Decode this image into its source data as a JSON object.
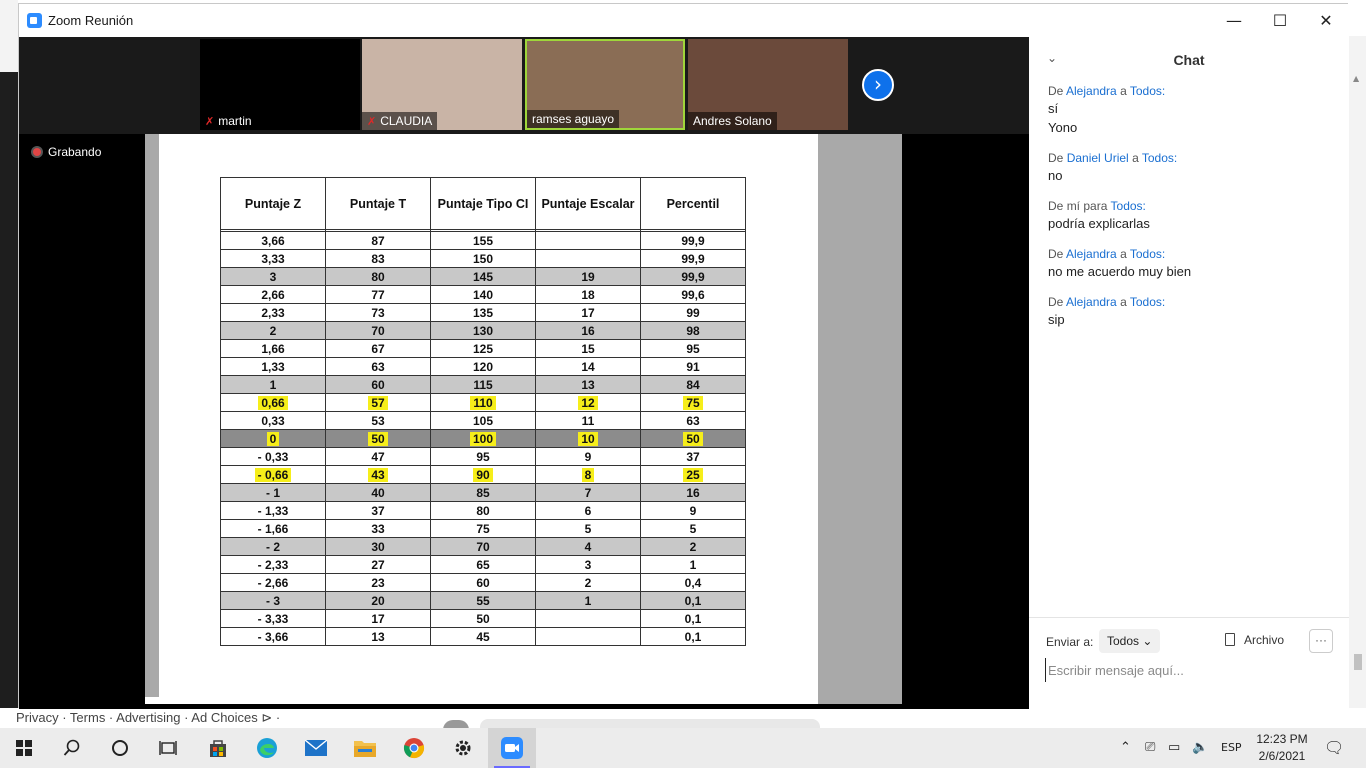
{
  "background": {
    "footer_links": "Privacy · Terms · Advertising · Ad Choices ⊳ ·"
  },
  "window": {
    "title": "Zoom Reunión",
    "controls": {
      "minimize": "—",
      "maximize": "☐",
      "close": "✕"
    }
  },
  "participants": [
    {
      "name": "martin",
      "muted": true,
      "bg": "#000000"
    },
    {
      "name": "CLAUDIA",
      "muted": true,
      "bg": "#c9b4a6"
    },
    {
      "name": "ramses aguayo",
      "muted": false,
      "bg": "#8a6d55"
    },
    {
      "name": "Andres Solano",
      "muted": false,
      "bg": "#6b4a3b"
    }
  ],
  "next_arrow": "›",
  "recording": {
    "label": "Grabando"
  },
  "table": {
    "headers": [
      "Puntaje Z",
      "Puntaje T",
      "Puntaje Tipo CI",
      "Puntaje Escalar",
      "Percentil"
    ],
    "rows": [
      {
        "cells": [
          "3,66",
          "87",
          "155",
          "",
          "99,9"
        ],
        "shade": "white"
      },
      {
        "cells": [
          "3,33",
          "83",
          "150",
          "",
          "99,9"
        ],
        "shade": "white"
      },
      {
        "cells": [
          "3",
          "80",
          "145",
          "19",
          "99,9"
        ],
        "shade": "gray"
      },
      {
        "cells": [
          "2,66",
          "77",
          "140",
          "18",
          "99,6"
        ],
        "shade": "white"
      },
      {
        "cells": [
          "2,33",
          "73",
          "135",
          "17",
          "99"
        ],
        "shade": "white"
      },
      {
        "cells": [
          "2",
          "70",
          "130",
          "16",
          "98"
        ],
        "shade": "gray"
      },
      {
        "cells": [
          "1,66",
          "67",
          "125",
          "15",
          "95"
        ],
        "shade": "white"
      },
      {
        "cells": [
          "1,33",
          "63",
          "120",
          "14",
          "91"
        ],
        "shade": "white"
      },
      {
        "cells": [
          "1",
          "60",
          "115",
          "13",
          "84"
        ],
        "shade": "gray"
      },
      {
        "cells": [
          "0,66",
          "57",
          "110",
          "12",
          "75"
        ],
        "shade": "white",
        "highlight": true
      },
      {
        "cells": [
          "0,33",
          "53",
          "105",
          "11",
          "63"
        ],
        "shade": "white"
      },
      {
        "cells": [
          "0",
          "50",
          "100",
          "10",
          "50"
        ],
        "shade": "dark",
        "highlight": true
      },
      {
        "cells": [
          "- 0,33",
          "47",
          "95",
          "9",
          "37"
        ],
        "shade": "white"
      },
      {
        "cells": [
          "- 0,66",
          "43",
          "90",
          "8",
          "25"
        ],
        "shade": "white",
        "highlight": true
      },
      {
        "cells": [
          "- 1",
          "40",
          "85",
          "7",
          "16"
        ],
        "shade": "gray"
      },
      {
        "cells": [
          "- 1,33",
          "37",
          "80",
          "6",
          "9"
        ],
        "shade": "white"
      },
      {
        "cells": [
          "- 1,66",
          "33",
          "75",
          "5",
          "5"
        ],
        "shade": "white"
      },
      {
        "cells": [
          "- 2",
          "30",
          "70",
          "4",
          "2"
        ],
        "shade": "gray"
      },
      {
        "cells": [
          "- 2,33",
          "27",
          "65",
          "3",
          "1"
        ],
        "shade": "white"
      },
      {
        "cells": [
          "- 2,66",
          "23",
          "60",
          "2",
          "0,4"
        ],
        "shade": "white"
      },
      {
        "cells": [
          "- 3",
          "20",
          "55",
          "1",
          "0,1"
        ],
        "shade": "gray"
      },
      {
        "cells": [
          "- 3,33",
          "17",
          "50",
          "",
          "0,1"
        ],
        "shade": "white"
      },
      {
        "cells": [
          "- 3,66",
          "13",
          "45",
          "",
          "0,1"
        ],
        "shade": "white"
      }
    ],
    "highlight_color": "#f6ee1a"
  },
  "chat": {
    "title": "Chat",
    "messages": [
      {
        "prefix": "De",
        "from": "Alejandra",
        "mid": "a",
        "to": "Todos:",
        "lines": [
          "sí",
          "Yono"
        ]
      },
      {
        "prefix": "De",
        "from": "Daniel Uriel",
        "mid": "a",
        "to": "Todos:",
        "lines": [
          "no"
        ]
      },
      {
        "prefix": "De",
        "from": "mí",
        "mid": "para",
        "to": "Todos:",
        "lines": [
          "podría explicarlas"
        ],
        "self": true
      },
      {
        "prefix": "De",
        "from": "Alejandra",
        "mid": "a",
        "to": "Todos:",
        "lines": [
          "no me acuerdo muy bien"
        ]
      },
      {
        "prefix": "De",
        "from": "Alejandra",
        "mid": "a",
        "to": "Todos:",
        "lines": [
          "sip"
        ]
      }
    ],
    "send_to_label": "Enviar a:",
    "send_to_value": "Todos",
    "file_label": "Archivo",
    "more_label": "···",
    "input_placeholder": "Escribir mensaje aquí...",
    "link_color": "#1a6fd1"
  },
  "taskbar": {
    "icons": [
      "windows-start",
      "search",
      "cortana",
      "task-view",
      "store",
      "edge",
      "mail",
      "file-explorer",
      "chrome",
      "settings",
      "zoom"
    ],
    "language": "ESP",
    "time": "12:23 PM",
    "date": "2/6/2021"
  }
}
